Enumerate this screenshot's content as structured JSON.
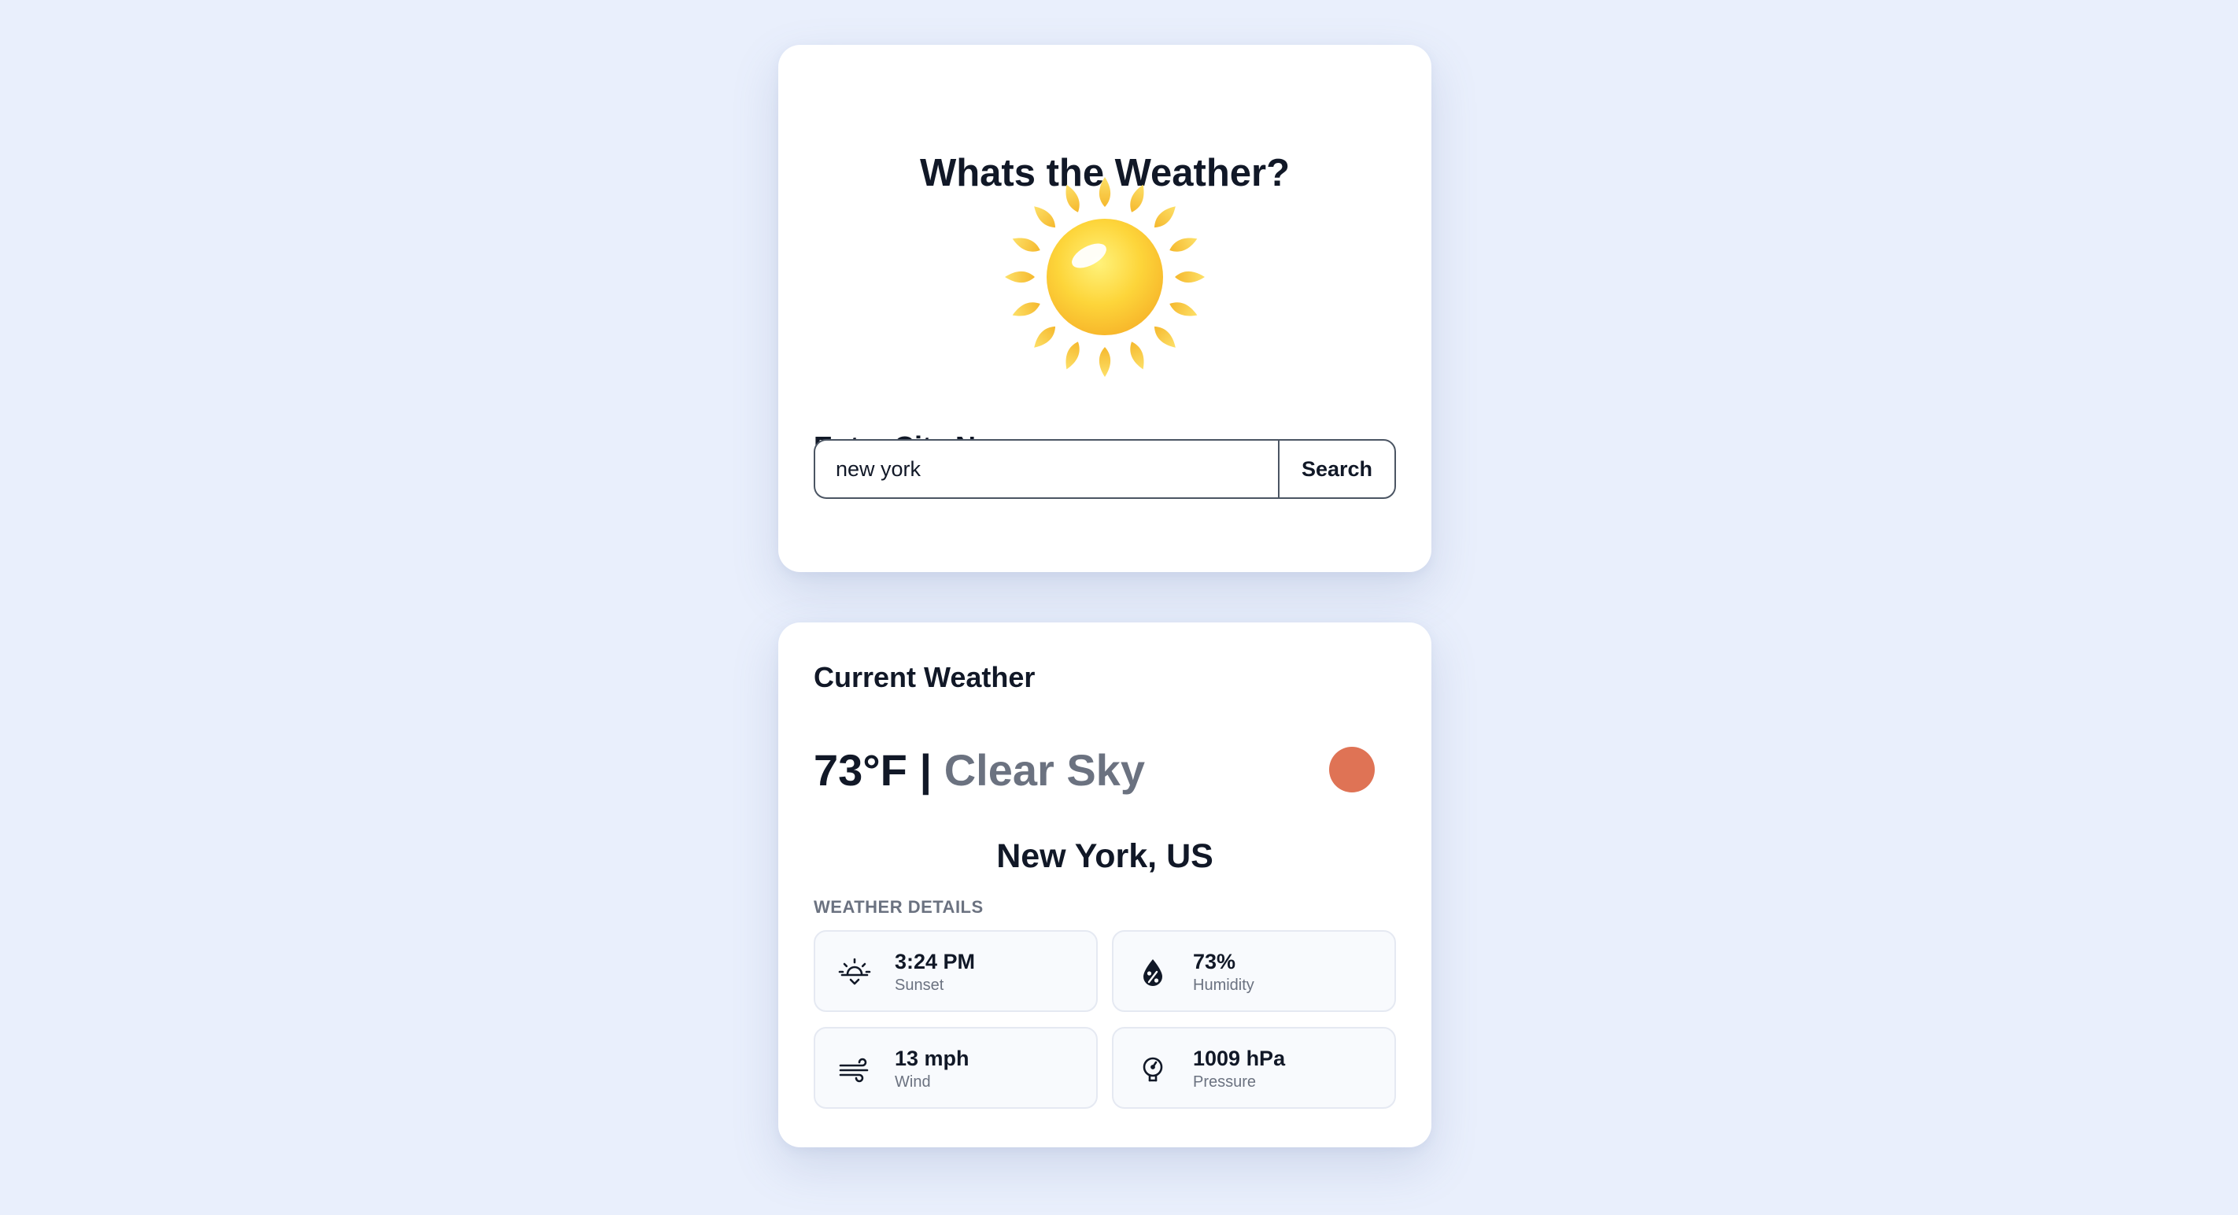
{
  "app": {
    "title": "Whats the Weather?",
    "hero_icon": "sun-icon"
  },
  "search": {
    "label": "Enter City Name:",
    "value": "new york",
    "button_label": "Search"
  },
  "current": {
    "heading": "Current Weather",
    "temperature": "73°F",
    "separator": "|",
    "condition": "Clear Sky",
    "condition_indicator_color": "#df7355",
    "location": "New York, US"
  },
  "details": {
    "heading": "WEATHER DETAILS",
    "items": [
      {
        "icon": "sunset-icon",
        "value": "3:24 PM",
        "label": "Sunset"
      },
      {
        "icon": "humidity-icon",
        "value": "73%",
        "label": "Humidity"
      },
      {
        "icon": "wind-icon",
        "value": "13 mph",
        "label": "Wind"
      },
      {
        "icon": "pressure-icon",
        "value": "1009 hPa",
        "label": "Pressure"
      }
    ]
  },
  "colors": {
    "page_background": "#e9effc",
    "card_background": "#ffffff",
    "text_primary": "#111827",
    "text_secondary": "#6b7280",
    "tile_background": "#f8fafd"
  }
}
